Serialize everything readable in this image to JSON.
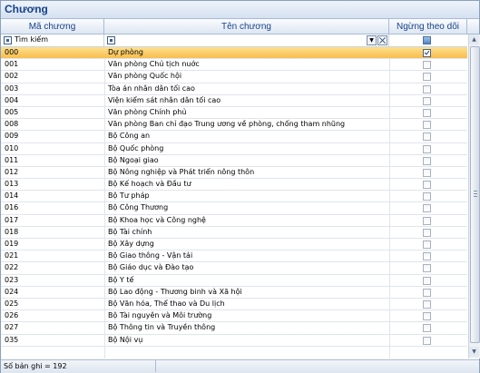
{
  "panel": {
    "title": "Chương"
  },
  "columns": {
    "code": "Mã chương",
    "name": "Tên chương",
    "inactive": "Ngừng theo dõi"
  },
  "filter": {
    "search_label": "Tìm kiếm"
  },
  "rows": [
    {
      "code": "000",
      "name": "Dự phòng",
      "inactive": true,
      "selected": true
    },
    {
      "code": "001",
      "name": "Văn phòng Chủ tịch nuớc",
      "inactive": false
    },
    {
      "code": "002",
      "name": "Văn phòng Quốc hội",
      "inactive": false
    },
    {
      "code": "003",
      "name": "Tòa án nhân dân tối cao",
      "inactive": false
    },
    {
      "code": "004",
      "name": "Viện kiểm sát nhân dân tối cao",
      "inactive": false
    },
    {
      "code": "005",
      "name": "Văn phòng Chính phủ",
      "inactive": false
    },
    {
      "code": "008",
      "name": "Văn phòng Ban chỉ đạo Trung ương về phòng, chống tham nhũng",
      "inactive": false
    },
    {
      "code": "009",
      "name": "Bộ Công an",
      "inactive": false
    },
    {
      "code": "010",
      "name": "Bộ Quốc phòng",
      "inactive": false
    },
    {
      "code": "011",
      "name": "Bộ Ngoại giao",
      "inactive": false
    },
    {
      "code": "012",
      "name": "Bộ Nông nghiệp và Phát triển nông thôn",
      "inactive": false
    },
    {
      "code": "013",
      "name": "Bộ Kế hoạch và Đầu tư",
      "inactive": false
    },
    {
      "code": "014",
      "name": "Bộ Tư pháp",
      "inactive": false
    },
    {
      "code": "016",
      "name": "Bộ Công Thương",
      "inactive": false
    },
    {
      "code": "017",
      "name": "Bộ Khoa học và Công nghệ",
      "inactive": false
    },
    {
      "code": "018",
      "name": "Bộ Tài chính",
      "inactive": false
    },
    {
      "code": "019",
      "name": "Bộ Xây dựng",
      "inactive": false
    },
    {
      "code": "021",
      "name": "Bộ Giao thông - Vận tải",
      "inactive": false
    },
    {
      "code": "022",
      "name": "Bộ Giáo dục và Đào tạo",
      "inactive": false
    },
    {
      "code": "023",
      "name": "Bộ Y tế",
      "inactive": false
    },
    {
      "code": "024",
      "name": "Bộ Lao động - Thương binh và Xã hội",
      "inactive": false
    },
    {
      "code": "025",
      "name": "Bộ Văn hóa, Thể thao và Du lịch",
      "inactive": false
    },
    {
      "code": "026",
      "name": "Bộ Tài nguyên và Môi trường",
      "inactive": false
    },
    {
      "code": "027",
      "name": "Bộ Thông tin và Truyền thông",
      "inactive": false
    },
    {
      "code": "035",
      "name": "Bộ Nội vụ",
      "inactive": false
    }
  ],
  "footer": {
    "record_count": "Số bản ghi = 192"
  }
}
